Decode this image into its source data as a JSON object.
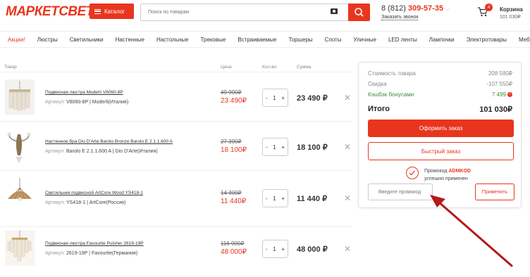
{
  "header": {
    "logo_part1": "МАРКЕТ",
    "logo_part2": "СВЕТА",
    "catalog_label": "Каталог",
    "search_placeholder": "Поиск по товарам",
    "phone_prefix": "8 (812)",
    "phone_number": "309-57-35",
    "callback_label": "Заказать звонок",
    "cart_label": "Корзина",
    "cart_count": "4",
    "cart_sum": "101 030₽"
  },
  "nav": [
    "Акции!",
    "Люстры",
    "Светильники",
    "Настенные",
    "Настольные",
    "Трековые",
    "Встраиваемые",
    "Торшеры",
    "Споты",
    "Уличные",
    "LED ленты",
    "Лампочки",
    "Электротовары",
    "Мебель"
  ],
  "table_headers": {
    "product": "Товар",
    "price": "Цена",
    "qty": "Кол-во",
    "sum": "Сумма"
  },
  "items": [
    {
      "name": "Подвесная люстра Moderli V8060-8P",
      "article_label": "Артикул:",
      "article": "V8060-8P | Moderli(Италия)",
      "old_price": "49 990₽",
      "price": "23 490₽",
      "qty": "1",
      "sum": "23 490 ₽"
    },
    {
      "name": "Настенное бра Dio D'Arte Barolo Bronze Barolo E 2.1.1.600 A",
      "article_label": "Артикул:",
      "article": "Barolo E 2.1.1.600 A | Dio D'Arte(Италия)",
      "old_price": "27 390₽",
      "price": "18 100₽",
      "qty": "1",
      "sum": "18 100 ₽"
    },
    {
      "name": "Светильник подвесной ArtCore Wood YS418-1",
      "article_label": "Артикул:",
      "article": "YS418-1 | ArtCore(Россия)",
      "old_price": "14 300₽",
      "price": "11 440₽",
      "qty": "1",
      "sum": "11 440 ₽"
    },
    {
      "name": "Подвесная люстра Favourite Pulsher 2619-19P",
      "article_label": "Артикул:",
      "article": "2619-19P | Favourite(Германия)",
      "old_price": "116 900₽",
      "price": "48 000₽",
      "qty": "1",
      "sum": "48 000 ₽"
    }
  ],
  "summary": {
    "goods_label": "Стоимость товара",
    "goods_value": "208 580₽",
    "discount_label": "Скидка",
    "discount_value": "-107 550₽",
    "cashback_label": "Кэшбэк бонусами",
    "cashback_value": "7 499",
    "total_label": "Итого",
    "total_value": "101 030₽",
    "order_btn": "Оформить заказ",
    "quick_btn": "Быстрый заказ",
    "promo_prefix": "Промокод",
    "promo_code": "ADMKOD",
    "promo_suffix": "успешно применен",
    "promo_placeholder": "Введите промокод",
    "apply_btn": "Применить"
  },
  "colors": {
    "accent": "#e8361e",
    "cashback": "#3b8f3b"
  }
}
